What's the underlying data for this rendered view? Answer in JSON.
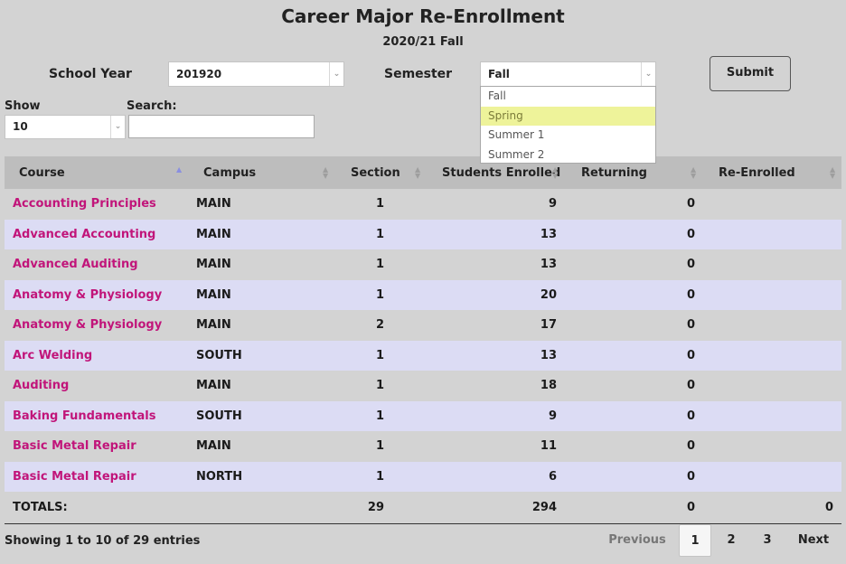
{
  "page": {
    "title": "Career Major Re-Enrollment",
    "subtitle": "2020/21 Fall"
  },
  "filters": {
    "school_year_label": "School Year",
    "school_year_value": "201920",
    "semester_label": "Semester",
    "semester_value": "Fall",
    "semester_options": [
      "Fall",
      "Spring",
      "Summer 1",
      "Summer 2"
    ],
    "semester_highlighted": "Spring",
    "submit_label": "Submit"
  },
  "controls": {
    "show_label": "Show",
    "show_value": "10",
    "search_label": "Search:",
    "search_value": ""
  },
  "table": {
    "columns": [
      "Course",
      "Campus",
      "Section",
      "Students Enrolled",
      "Returning",
      "Re-Enrolled"
    ],
    "sorted_column": "Course",
    "rows": [
      {
        "course": "Accounting Principles",
        "campus": "MAIN",
        "section": "1",
        "enrolled": "9",
        "returning": "0",
        "reenrolled": ""
      },
      {
        "course": "Advanced Accounting",
        "campus": "MAIN",
        "section": "1",
        "enrolled": "13",
        "returning": "0",
        "reenrolled": ""
      },
      {
        "course": "Advanced Auditing",
        "campus": "MAIN",
        "section": "1",
        "enrolled": "13",
        "returning": "0",
        "reenrolled": ""
      },
      {
        "course": "Anatomy & Physiology",
        "campus": "MAIN",
        "section": "1",
        "enrolled": "20",
        "returning": "0",
        "reenrolled": ""
      },
      {
        "course": "Anatomy & Physiology",
        "campus": "MAIN",
        "section": "2",
        "enrolled": "17",
        "returning": "0",
        "reenrolled": ""
      },
      {
        "course": "Arc Welding",
        "campus": "SOUTH",
        "section": "1",
        "enrolled": "13",
        "returning": "0",
        "reenrolled": ""
      },
      {
        "course": "Auditing",
        "campus": "MAIN",
        "section": "1",
        "enrolled": "18",
        "returning": "0",
        "reenrolled": ""
      },
      {
        "course": "Baking Fundamentals",
        "campus": "SOUTH",
        "section": "1",
        "enrolled": "9",
        "returning": "0",
        "reenrolled": ""
      },
      {
        "course": "Basic Metal Repair",
        "campus": "MAIN",
        "section": "1",
        "enrolled": "11",
        "returning": "0",
        "reenrolled": ""
      },
      {
        "course": "Basic Metal Repair",
        "campus": "NORTH",
        "section": "1",
        "enrolled": "6",
        "returning": "0",
        "reenrolled": ""
      }
    ],
    "totals": {
      "label": "TOTALS:",
      "section": "29",
      "enrolled": "294",
      "returning": "0",
      "reenrolled": "0"
    }
  },
  "footer": {
    "info": "Showing 1 to 10 of 29 entries",
    "previous": "Previous",
    "pages": [
      "1",
      "2",
      "3"
    ],
    "current_page": "1",
    "next": "Next"
  },
  "colors": {
    "link": "#c1157a",
    "row_alt": "#dcdcf4",
    "highlight": "#eef39a",
    "background": "#d3d3d3"
  }
}
